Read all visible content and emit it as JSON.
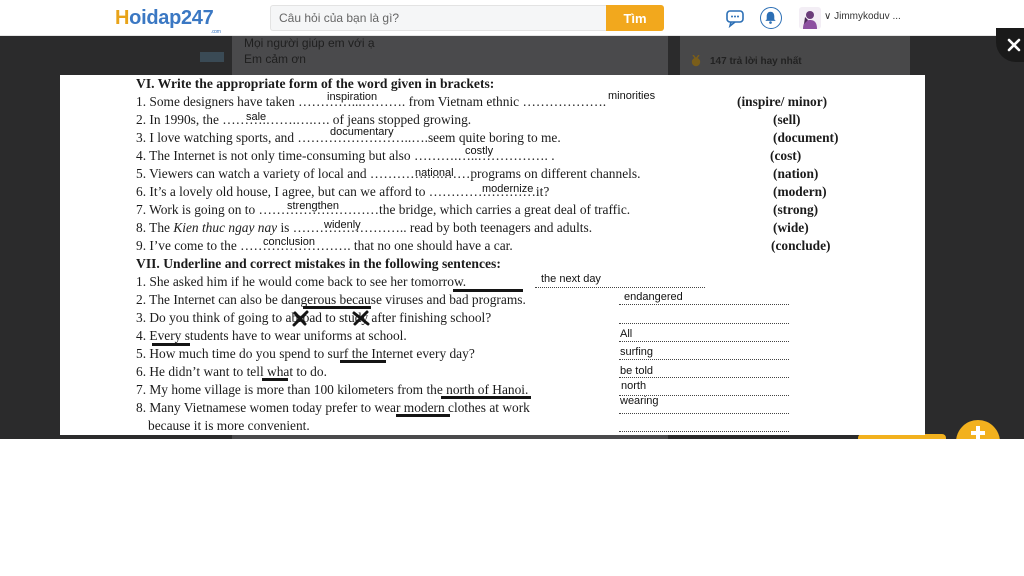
{
  "header": {
    "logo_part1": "H",
    "logo_part2": "oidap247",
    "logo_suffix": ".com",
    "search_placeholder": "Câu hỏi của bạn là gì?",
    "search_button": "Tìm",
    "username": "∨ Jimmykoduv ..."
  },
  "background": {
    "text_line1": "Mọi người giúp em với ạ",
    "text_line2": "Em cảm ơn",
    "right_text": "147 trả lời hay nhất"
  },
  "worksheet": {
    "section6_title": "VI. Write the appropriate form of the word given in brackets:",
    "section6": [
      {
        "text": "1. Some designers have taken …………...………. from Vietnam ethnic ……………….",
        "hint": "(inspire/ minor)",
        "answers": [
          "inspiration",
          "minorities"
        ]
      },
      {
        "text": "2. In 1990s, the ……….…….….…. of jeans stopped growing.",
        "hint": "(sell)",
        "answers": [
          "sale"
        ]
      },
      {
        "text": "3. I love watching sports, and ……………………..….seem quite boring to me.",
        "hint": "(document)",
        "answers": [
          "documentary"
        ]
      },
      {
        "text": "4. The Internet is not only time-consuming but also ……….…..……………. .",
        "hint": "(cost)",
        "answers": [
          "costly"
        ]
      },
      {
        "text": "5. Viewers can watch a variety of local and ………….….……programs on different channels.",
        "hint": "(nation)",
        "answers": [
          "national"
        ]
      },
      {
        "text": "6. It’s a lovely old house, I agree, but can we afford to ……………………it?",
        "hint": "(modern)",
        "answers": [
          "modernize"
        ]
      },
      {
        "text": "7. Work is going on to ………………………the bridge, which carries a great deal of traffic.",
        "hint": "(strong)",
        "answers": [
          "strengthen"
        ]
      },
      {
        "text_pre": "8. The ",
        "text_italic": "Kien thuc ngay nay",
        "text_post": " is …………………….. read by both teenagers and adults.",
        "hint": "(wide)",
        "answers": [
          "widenly"
        ]
      },
      {
        "text": "9. I’ve come to the ……………………. that no one should have a car.",
        "hint": "(conclude)",
        "answers": [
          "conclusion"
        ]
      }
    ],
    "section7_title": "VII. Underline and correct mistakes in the following sentences:",
    "section7": [
      {
        "text": "1. She asked him if he would come back to see her tomorrow.",
        "answer": "the next day"
      },
      {
        "text": "2. The Internet can also be dangerous because viruses and bad programs.",
        "answer": "endangered"
      },
      {
        "text": "3. Do you think of going to abroad to study after finishing school?",
        "answer": ""
      },
      {
        "text": "4. Every students have to wear uniforms at school.",
        "answer": "All"
      },
      {
        "text": "5. How much time do you spend to surf the Internet every day?",
        "answer": "surfing"
      },
      {
        "text": "6. He didn’t want to tell what to do.",
        "answer": "be told"
      },
      {
        "text": "7. My home village is more than 100 kilometers from the north of Hanoi.",
        "answer": "north"
      },
      {
        "text": "8. Many Vietnamese women today prefer to wear modern clothes at work",
        "answer": "wearing"
      },
      {
        "text": "because it is more convenient.",
        "answer": ""
      }
    ]
  },
  "colors": {
    "search_button": "#f2a81d",
    "logo_orange": "#e8a319",
    "logo_blue": "#3b78c3",
    "overlay": "#2b2b2c"
  }
}
